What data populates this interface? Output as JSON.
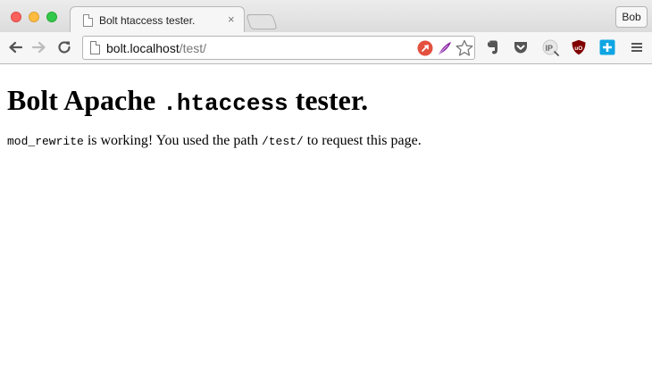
{
  "browser": {
    "tab": {
      "title": "Bolt htaccess tester.",
      "close_glyph": "×"
    },
    "profile_name": "Bob",
    "address_bar": {
      "host": "bolt.localhost",
      "path": "/test/"
    },
    "extensions": [
      "evernote-icon",
      "pocket-icon",
      "ip-icon",
      "ublock-icon",
      "plus-icon"
    ],
    "colors": {
      "close": "#fc605c",
      "minimize": "#fdbc40",
      "maximize": "#34c84a",
      "ublock": "#800000",
      "plus_ext": "#0fa5e4"
    }
  },
  "page": {
    "heading": {
      "part1": "Bolt Apache ",
      "code": ".htaccess",
      "part2": " tester."
    },
    "message": {
      "code1": "mod_rewrite",
      "text1": " is working! You used the path ",
      "code2": "/test/",
      "text2": " to request this page."
    }
  }
}
